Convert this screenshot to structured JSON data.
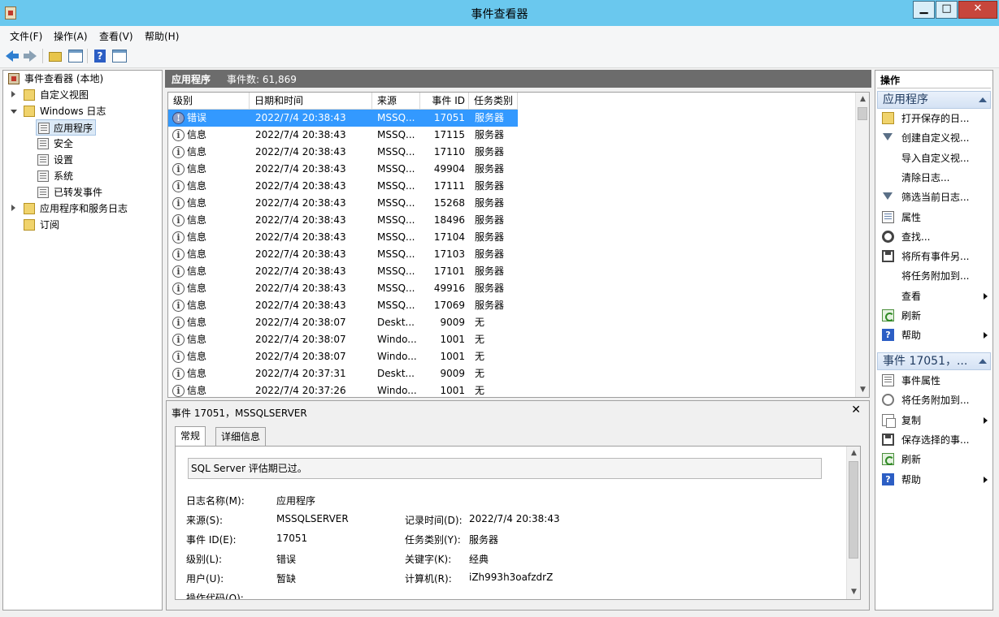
{
  "window": {
    "title": "事件查看器",
    "min": "▁",
    "max": "□",
    "close": "✕"
  },
  "menu": [
    "文件(F)",
    "操作(A)",
    "查看(V)",
    "帮助(H)"
  ],
  "tree": {
    "root": "事件查看器 (本地)",
    "custom_views": "自定义视图",
    "windows_logs": "Windows 日志",
    "logs": [
      "应用程序",
      "安全",
      "设置",
      "系统",
      "已转发事件"
    ],
    "app_service_logs": "应用程序和服务日志",
    "subscriptions": "订阅"
  },
  "center": {
    "title": "应用程序",
    "count": "事件数: 61,869"
  },
  "columns": [
    "级别",
    "日期和时间",
    "来源",
    "事件 ID",
    "任务类别"
  ],
  "events": [
    {
      "level": "错误",
      "time": "2022/7/4 20:38:43",
      "source": "MSSQ...",
      "id": "17051",
      "cat": "服务器",
      "type": "error"
    },
    {
      "level": "信息",
      "time": "2022/7/4 20:38:43",
      "source": "MSSQ...",
      "id": "17115",
      "cat": "服务器",
      "type": "info"
    },
    {
      "level": "信息",
      "time": "2022/7/4 20:38:43",
      "source": "MSSQ...",
      "id": "17110",
      "cat": "服务器",
      "type": "info"
    },
    {
      "level": "信息",
      "time": "2022/7/4 20:38:43",
      "source": "MSSQ...",
      "id": "49904",
      "cat": "服务器",
      "type": "info"
    },
    {
      "level": "信息",
      "time": "2022/7/4 20:38:43",
      "source": "MSSQ...",
      "id": "17111",
      "cat": "服务器",
      "type": "info"
    },
    {
      "level": "信息",
      "time": "2022/7/4 20:38:43",
      "source": "MSSQ...",
      "id": "15268",
      "cat": "服务器",
      "type": "info"
    },
    {
      "level": "信息",
      "time": "2022/7/4 20:38:43",
      "source": "MSSQ...",
      "id": "18496",
      "cat": "服务器",
      "type": "info"
    },
    {
      "level": "信息",
      "time": "2022/7/4 20:38:43",
      "source": "MSSQ...",
      "id": "17104",
      "cat": "服务器",
      "type": "info"
    },
    {
      "level": "信息",
      "time": "2022/7/4 20:38:43",
      "source": "MSSQ...",
      "id": "17103",
      "cat": "服务器",
      "type": "info"
    },
    {
      "level": "信息",
      "time": "2022/7/4 20:38:43",
      "source": "MSSQ...",
      "id": "17101",
      "cat": "服务器",
      "type": "info"
    },
    {
      "level": "信息",
      "time": "2022/7/4 20:38:43",
      "source": "MSSQ...",
      "id": "49916",
      "cat": "服务器",
      "type": "info"
    },
    {
      "level": "信息",
      "time": "2022/7/4 20:38:43",
      "source": "MSSQ...",
      "id": "17069",
      "cat": "服务器",
      "type": "info"
    },
    {
      "level": "信息",
      "time": "2022/7/4 20:38:07",
      "source": "Deskt...",
      "id": "9009",
      "cat": "无",
      "type": "info"
    },
    {
      "level": "信息",
      "time": "2022/7/4 20:38:07",
      "source": "Windo...",
      "id": "1001",
      "cat": "无",
      "type": "info"
    },
    {
      "level": "信息",
      "time": "2022/7/4 20:38:07",
      "source": "Windo...",
      "id": "1001",
      "cat": "无",
      "type": "info"
    },
    {
      "level": "信息",
      "time": "2022/7/4 20:37:31",
      "source": "Deskt...",
      "id": "9009",
      "cat": "无",
      "type": "info"
    },
    {
      "level": "信息",
      "time": "2022/7/4 20:37:26",
      "source": "Windo...",
      "id": "1001",
      "cat": "无",
      "type": "info"
    }
  ],
  "detail": {
    "title": "事件 17051，MSSQLSERVER",
    "tabs": [
      "常规",
      "详细信息"
    ],
    "message": "SQL Server 评估期已过。",
    "fields": {
      "log_name_label": "日志名称(M):",
      "log_name": "应用程序",
      "source_label": "来源(S):",
      "source": "MSSQLSERVER",
      "logged_label": "记录时间(D):",
      "logged": "2022/7/4 20:38:43",
      "event_id_label": "事件 ID(E):",
      "event_id": "17051",
      "task_label": "任务类别(Y):",
      "task": "服务器",
      "level_label": "级别(L):",
      "level": "错误",
      "keywords_label": "关键字(K):",
      "keywords": "经典",
      "user_label": "用户(U):",
      "user": "暂缺",
      "computer_label": "计算机(R):",
      "computer": "iZh993h3oafzdrZ",
      "opcode_label": "操作代码(O):"
    }
  },
  "actions": {
    "header": "操作",
    "section1": "应用程序",
    "items1": [
      "打开保存的日...",
      "创建自定义视...",
      "导入自定义视...",
      "清除日志...",
      "筛选当前日志...",
      "属性",
      "查找...",
      "将所有事件另...",
      "将任务附加到...",
      "查看",
      "刷新",
      "帮助"
    ],
    "section2": "事件 17051，...",
    "items2": [
      "事件属性",
      "将任务附加到...",
      "复制",
      "保存选择的事...",
      "刷新",
      "帮助"
    ]
  }
}
